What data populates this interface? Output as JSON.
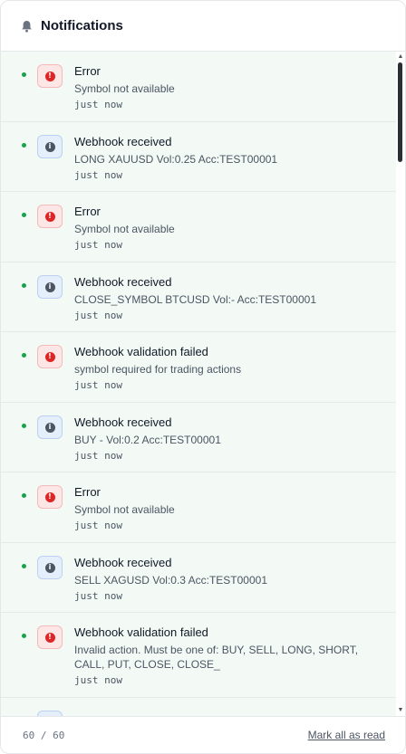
{
  "header": {
    "title": "Notifications",
    "icon": "bell-icon"
  },
  "notifications": [
    {
      "type": "error",
      "title": "Error",
      "lines": [
        "Symbol not available"
      ],
      "time": "just now"
    },
    {
      "type": "info",
      "title": "Webhook received",
      "lines": [
        "LONG XAUUSD Vol:0.25 Acc:TEST00001"
      ],
      "time": "just now"
    },
    {
      "type": "error",
      "title": "Error",
      "lines": [
        "Symbol not available"
      ],
      "time": "just now"
    },
    {
      "type": "info",
      "title": "Webhook received",
      "lines": [
        "CLOSE_SYMBOL BTCUSD Vol:- Acc:TEST00001"
      ],
      "time": "just now"
    },
    {
      "type": "error",
      "title": "Webhook validation failed",
      "lines": [
        "symbol required for trading actions"
      ],
      "time": "just now"
    },
    {
      "type": "info",
      "title": "Webhook received",
      "lines": [
        "BUY - Vol:0.2 Acc:TEST00001"
      ],
      "time": "just now"
    },
    {
      "type": "error",
      "title": "Error",
      "lines": [
        "Symbol not available"
      ],
      "time": "just now"
    },
    {
      "type": "info",
      "title": "Webhook received",
      "lines": [
        "SELL XAGUSD Vol:0.3 Acc:TEST00001"
      ],
      "time": "just now"
    },
    {
      "type": "error",
      "title": "Webhook validation failed",
      "lines": [
        "Invalid action. Must be one of: BUY, SELL, LONG, SHORT,",
        "CALL, PUT, CLOSE, CLOSE_"
      ],
      "time": "just now"
    }
  ],
  "footer": {
    "counter": "60 / 60",
    "mark_all_label": "Mark all as read"
  },
  "colors": {
    "unread_dot": "#16a34a",
    "unread_bg": "#f3faf5",
    "error": "#dc2626",
    "info": "#4b5563"
  }
}
